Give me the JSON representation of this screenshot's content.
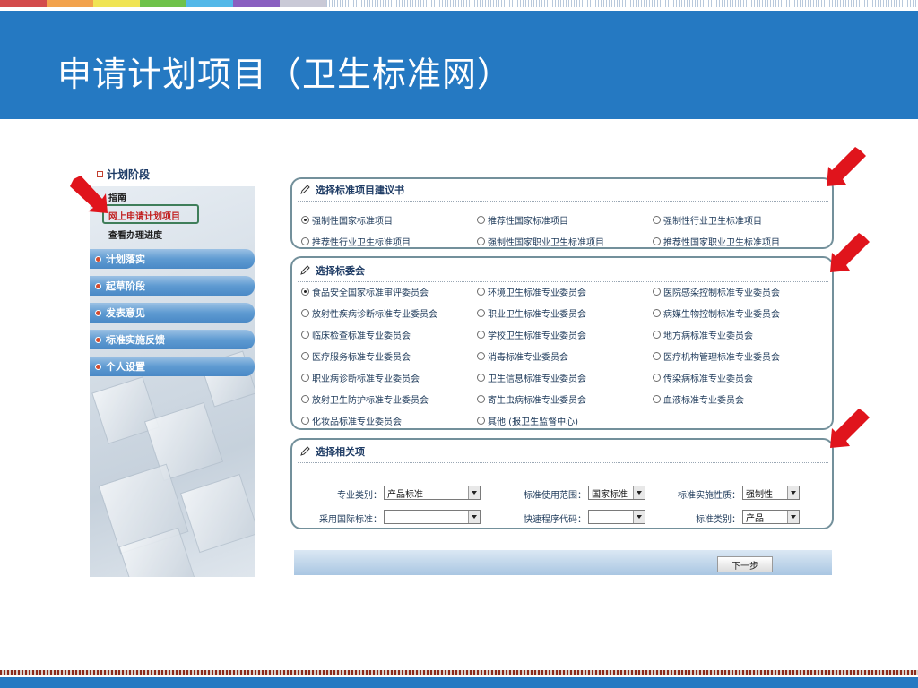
{
  "slide": {
    "title": "申请计划项目（卫生标准网）",
    "colors": {
      "header": "#2579c2",
      "strip": [
        "#d34b4b",
        "#f2a24c",
        "#f0e454",
        "#6fc24a",
        "#53b8e8",
        "#8a5fc0",
        "#c9c9d6"
      ],
      "arrow": "#e0141c"
    }
  },
  "sidebar": {
    "stage_head": "计划阶段",
    "sub_links": [
      "指南",
      "网上申请计划项目",
      "查看办理进度"
    ],
    "menu": [
      "计划落实",
      "起草阶段",
      "发表意见",
      "标准实施反馈",
      "个人设置"
    ]
  },
  "sections": {
    "proposal": {
      "title": "选择标准项目建议书",
      "options": [
        {
          "label": "强制性国家标准项目",
          "checked": true
        },
        {
          "label": "推荐性国家标准项目",
          "checked": false
        },
        {
          "label": "强制性行业卫生标准项目",
          "checked": false
        },
        {
          "label": "推荐性行业卫生标准项目",
          "checked": false
        },
        {
          "label": "强制性国家职业卫生标准项目",
          "checked": false
        },
        {
          "label": "推荐性国家职业卫生标准项目",
          "checked": false
        }
      ]
    },
    "committee": {
      "title": "选择标委会",
      "options": [
        {
          "label": "食品安全国家标准审评委员会",
          "checked": true
        },
        {
          "label": "环境卫生标准专业委员会",
          "checked": false
        },
        {
          "label": "医院感染控制标准专业委员会",
          "checked": false
        },
        {
          "label": "放射性疾病诊断标准专业委员会",
          "checked": false
        },
        {
          "label": "职业卫生标准专业委员会",
          "checked": false
        },
        {
          "label": "病媒生物控制标准专业委员会",
          "checked": false
        },
        {
          "label": "临床检查标准专业委员会",
          "checked": false
        },
        {
          "label": "学校卫生标准专业委员会",
          "checked": false
        },
        {
          "label": "地方病标准专业委员会",
          "checked": false
        },
        {
          "label": "医疗服务标准专业委员会",
          "checked": false
        },
        {
          "label": "消毒标准专业委员会",
          "checked": false
        },
        {
          "label": "医疗机构管理标准专业委员会",
          "checked": false
        },
        {
          "label": "职业病诊断标准专业委员会",
          "checked": false
        },
        {
          "label": "卫生信息标准专业委员会",
          "checked": false
        },
        {
          "label": "传染病标准专业委员会",
          "checked": false
        },
        {
          "label": "放射卫生防护标准专业委员会",
          "checked": false
        },
        {
          "label": "寄生虫病标准专业委员会",
          "checked": false
        },
        {
          "label": "血液标准专业委员会",
          "checked": false
        },
        {
          "label": "化妆品标准专业委员会",
          "checked": false
        },
        {
          "label": "其他 (报卫生监督中心)",
          "checked": false
        }
      ]
    },
    "related": {
      "title": "选择相关项",
      "fields": [
        {
          "label": "专业类别：",
          "value": "产品标准"
        },
        {
          "label": "标准使用范围：",
          "value": "国家标准"
        },
        {
          "label": "标准实施性质：",
          "value": "强制性"
        },
        {
          "label": "采用国际标准：",
          "value": ""
        },
        {
          "label": "快速程序代码：",
          "value": ""
        },
        {
          "label": "标准类别：",
          "value": "产品"
        }
      ]
    }
  },
  "footer": {
    "next_label": "下一步"
  }
}
